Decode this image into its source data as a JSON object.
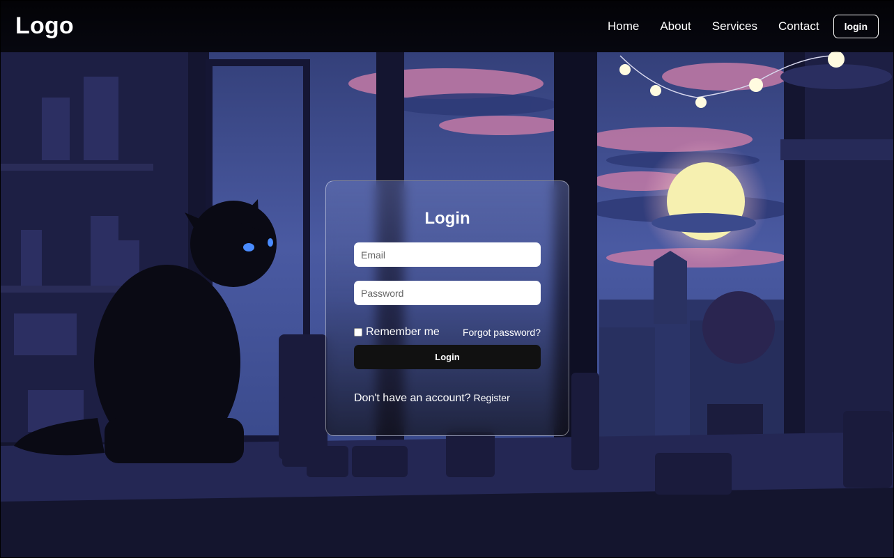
{
  "navbar": {
    "logo": "Logo",
    "links": [
      "Home",
      "About",
      "Services",
      "Contact"
    ],
    "login_button": "login"
  },
  "login_card": {
    "title": "Login",
    "email_placeholder": "Email",
    "password_placeholder": "Password",
    "remember_label": "Remember me",
    "forgot_link": "Forgot password?",
    "submit_label": "Login",
    "no_account_text": "Don't have an account?",
    "register_link": "Register"
  },
  "colors": {
    "sky": "#3e4f95",
    "clouds": "#c07aa8",
    "moon": "#f6f0b0",
    "button": "#111111"
  }
}
